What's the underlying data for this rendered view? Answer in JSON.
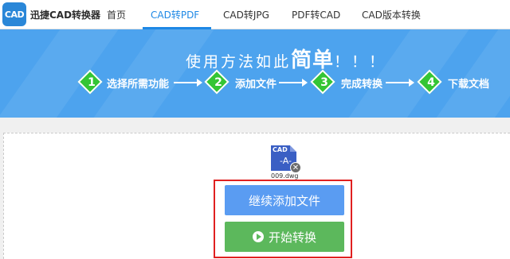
{
  "app": {
    "logo_text": "CAD",
    "brand": "迅捷CAD转换器"
  },
  "nav": {
    "items": [
      {
        "label": "首页"
      },
      {
        "label": "CAD转PDF"
      },
      {
        "label": "CAD转JPG"
      },
      {
        "label": "PDF转CAD"
      },
      {
        "label": "CAD版本转换"
      }
    ],
    "active_index": 1
  },
  "banner": {
    "tagline_pre": "使用方法如此",
    "tagline_big": "简单",
    "tagline_post": "！！！",
    "steps": [
      {
        "num": "1",
        "label": "选择所需功能"
      },
      {
        "num": "2",
        "label": "添加文件"
      },
      {
        "num": "3",
        "label": "完成转换"
      },
      {
        "num": "4",
        "label": "下载文档"
      }
    ]
  },
  "file": {
    "type": "CAD",
    "glyph": "-A-",
    "remove": "✕",
    "name": "009.dwg"
  },
  "buttons": {
    "add_more": "继续添加文件",
    "start": "开始转换"
  },
  "colors": {
    "accent": "#1e88e5",
    "banner": "#4da3ee",
    "step_green": "#34c534",
    "add_btn": "#5a9cf2",
    "start_btn": "#5cb85c",
    "highlight": "#e02020"
  }
}
